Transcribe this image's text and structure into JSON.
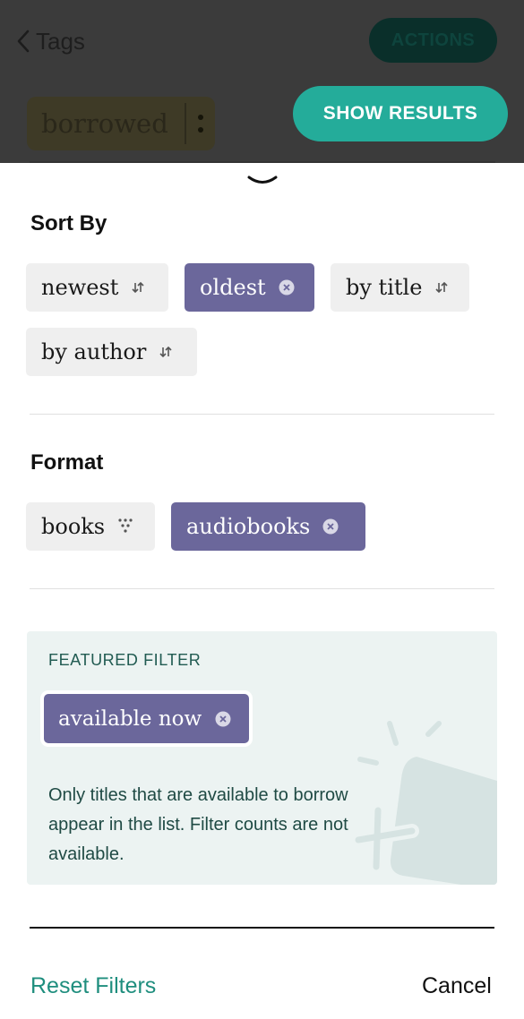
{
  "header": {
    "back_label": "Tags",
    "actions_label": "ACTIONS",
    "tag_name": "borrowed",
    "show_results_label": "SHOW RESULTS"
  },
  "sort": {
    "title": "Sort By",
    "options": [
      {
        "label": "newest",
        "selected": false,
        "icon": "sort-arrows-icon"
      },
      {
        "label": "oldest",
        "selected": true,
        "icon": "remove-x-icon"
      },
      {
        "label": "by title",
        "selected": false,
        "icon": "sort-arrows-icon"
      },
      {
        "label": "by author",
        "selected": false,
        "icon": "sort-arrows-icon"
      }
    ]
  },
  "format": {
    "title": "Format",
    "options": [
      {
        "label": "books",
        "selected": false,
        "icon": "filter-funnel-icon"
      },
      {
        "label": "audiobooks",
        "selected": true,
        "icon": "remove-x-icon"
      }
    ]
  },
  "featured": {
    "title": "FEATURED FILTER",
    "filter_label": "available now",
    "description": "Only titles that are available to borrow appear in the list. Filter counts are not available."
  },
  "footer": {
    "reset_label": "Reset Filters",
    "cancel_label": "Cancel"
  },
  "colors": {
    "accent_teal": "#24ac9a",
    "selected_chip": "#6b679b",
    "chip_bg": "#efefef",
    "featured_bg": "#ecf3f2",
    "link_teal": "#1f8e7e"
  }
}
